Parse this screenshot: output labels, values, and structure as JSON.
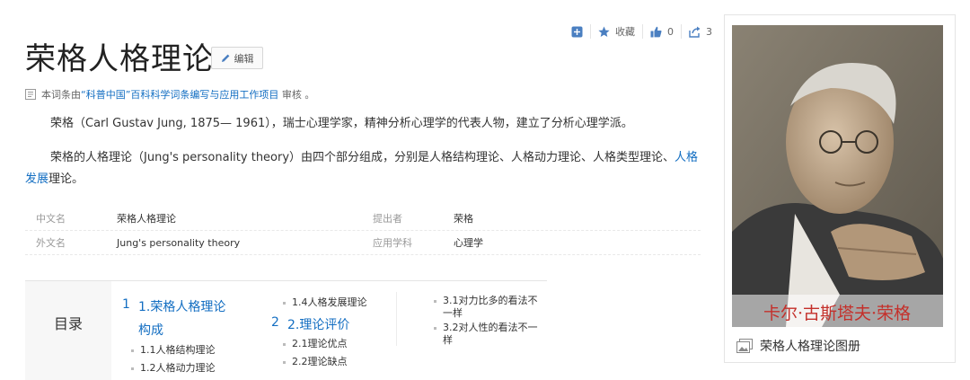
{
  "toolbar": {
    "collect_label": "收藏",
    "like_count": "0",
    "share_count": "3"
  },
  "title": "荣格人格理论",
  "edit_label": "编辑",
  "review": {
    "prefix": "本词条由",
    "link": "“科普中国”百科科学词条编写与应用工作项目",
    "suffix": "审核 。"
  },
  "paragraphs": [
    {
      "text": "荣格（Carl Gustav Jung, 1875— 1961），瑞士心理学家，精神分析心理学的代表人物，建立了分析心理学派。"
    },
    {
      "before": "荣格的人格理论（Jung's personality theory）由四个部分组成，分别是人格结构理论、人格动力理论、人格类型理论、",
      "link": "人格发展",
      "after": "理论。"
    }
  ],
  "basic_info": [
    {
      "l1": "中文名",
      "v1": "荣格人格理论",
      "l2": "提出者",
      "v2": "荣格"
    },
    {
      "l1": "外文名",
      "v1": "Jung's personality theory",
      "l2": "应用学科",
      "v2": "心理学"
    }
  ],
  "catalog": {
    "title": "目录",
    "sec1": {
      "num": "1",
      "label_a": "1.荣格人格理论",
      "label_b": "构成"
    },
    "sec1_items": [
      "1.1人格结构理论",
      "1.2人格动力理论"
    ],
    "col2_top": "1.4人格发展理论",
    "sec2": {
      "num": "2",
      "label": "2.理论评价"
    },
    "sec2_items": [
      "2.1理论优点",
      "2.2理论缺点"
    ],
    "col3": [
      {
        "a": "3.1对力比多的看法不",
        "b": "一样"
      },
      {
        "a": "3.2对人性的看法不一",
        "b": "样"
      }
    ]
  },
  "image": {
    "overlay_text": "卡尔·古斯塔夫·荣格",
    "caption": "荣格人格理论图册"
  },
  "colors": {
    "link": "#136ec2",
    "overlay_text": "#c4302b"
  }
}
